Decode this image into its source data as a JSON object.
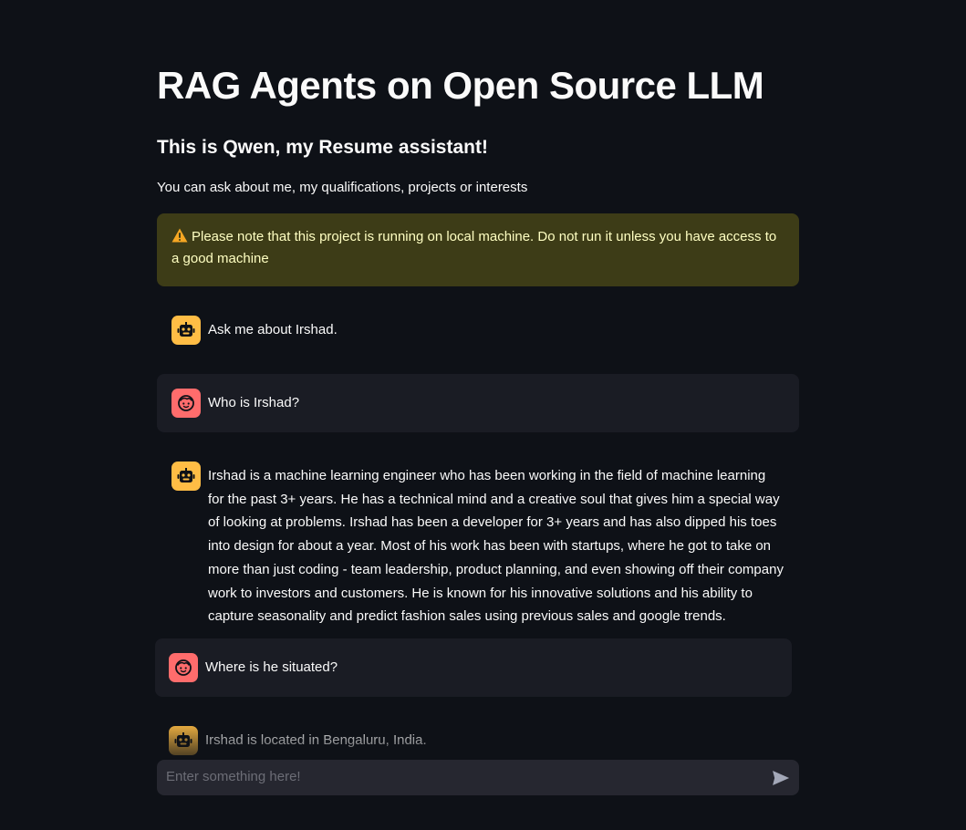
{
  "header": {
    "title": "RAG Agents on Open Source LLM",
    "subtitle": "This is Qwen, my Resume assistant!",
    "caption": "You can ask about me, my qualifications, projects or interests"
  },
  "warning": {
    "icon": "warning-icon",
    "text": "Please note that this project is running on local machine. Do not run it unless you have access to a good machine"
  },
  "messages": [
    {
      "role": "assistant",
      "avatar_icon": "robot-icon",
      "text": "Ask me about Irshad."
    },
    {
      "role": "user",
      "avatar_icon": "face-icon",
      "text": "Who is Irshad?"
    },
    {
      "role": "assistant",
      "avatar_icon": "robot-icon",
      "text": "Irshad is a machine learning engineer who has been working in the field of machine learning for the past 3+ years. He has a technical mind and a creative soul that gives him a special way of looking at problems. Irshad has been a developer for 3+ years and has also dipped his toes into design for about a year. Most of his work has been with startups, where he got to take on more than just coding - team leadership, product planning, and even showing off their company work to investors and customers. He is known for his innovative solutions and his ability to capture seasonality and predict fashion sales using previous sales and google trends."
    },
    {
      "role": "user",
      "avatar_icon": "face-icon",
      "text": "Where is he situated?"
    },
    {
      "role": "assistant",
      "avatar_icon": "robot-icon",
      "text": "Irshad is located in Bengaluru, India."
    }
  ],
  "chat_input": {
    "placeholder": "Enter something here!",
    "value": "",
    "send_icon": "send-icon"
  },
  "colors": {
    "background": "#0e1117",
    "warning_bg": "#3d3c17",
    "warning_text": "#ffffc2",
    "user_message_bg": "#1a1c24",
    "assistant_avatar": "#ffbd45",
    "user_avatar": "#ff6c6c",
    "input_bg": "#262730"
  }
}
